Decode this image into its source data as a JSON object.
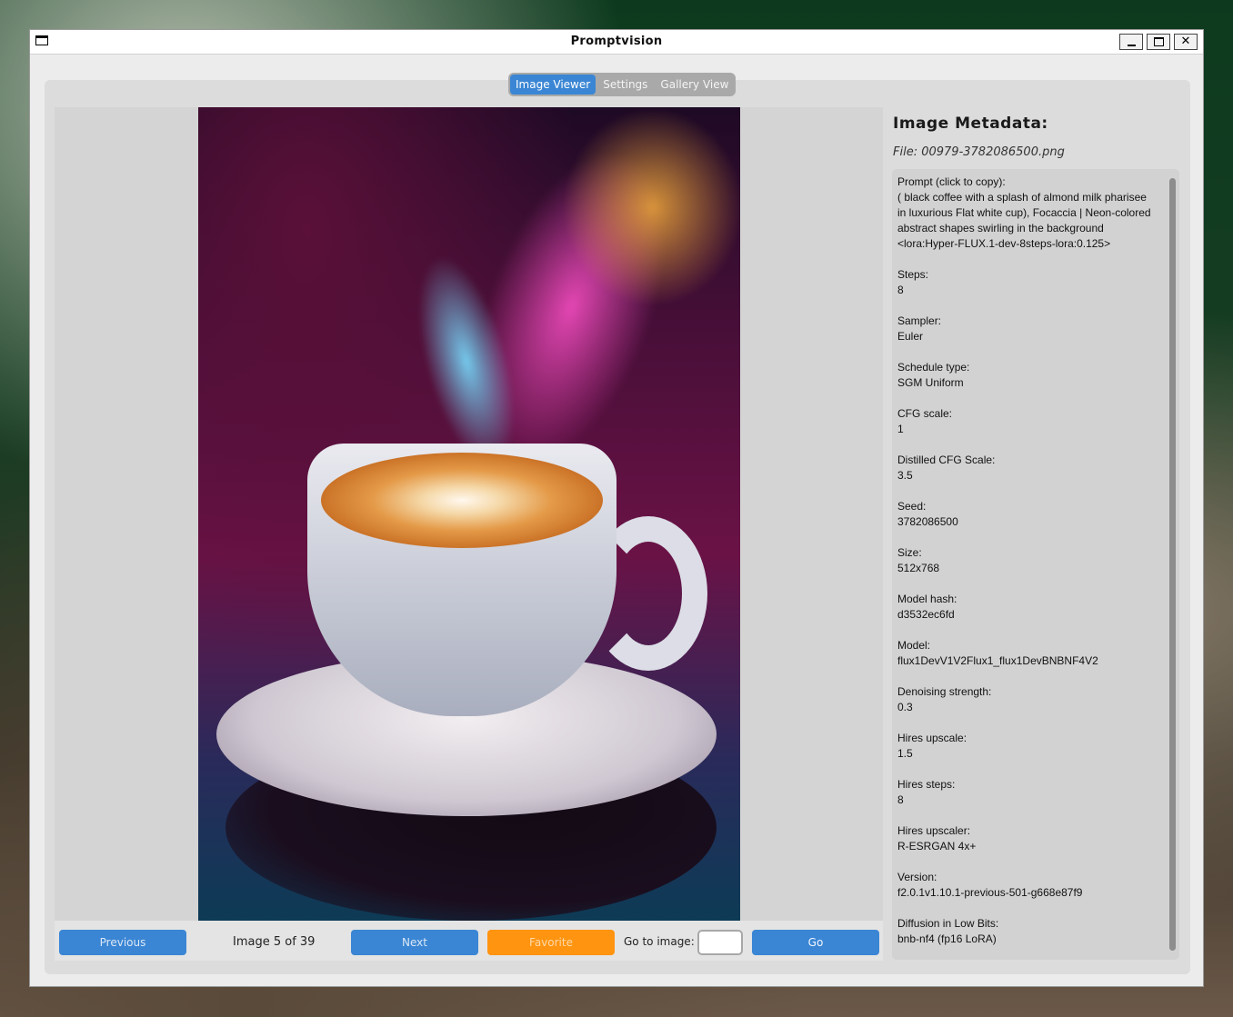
{
  "window": {
    "title": "Promptvision"
  },
  "tabs": [
    {
      "label": "Image Viewer",
      "active": true
    },
    {
      "label": "Settings",
      "active": false
    },
    {
      "label": "Gallery View",
      "active": false
    }
  ],
  "nav": {
    "previous_label": "Previous",
    "counter": "Image 5 of 39",
    "next_label": "Next",
    "favorite_label": "Favorite",
    "goto_label": "Go to image:",
    "goto_value": "",
    "go_label": "Go"
  },
  "metadata": {
    "title": "Image Metadata:",
    "file": "File: 00979-3782086500.png",
    "prompt_label": "Prompt (click to copy):",
    "prompt_value": "( black coffee with a splash of almond milk pharisee in luxurious Flat white cup), Focaccia | Neon-colored abstract shapes swirling in the background <lora:Hyper-FLUX.1-dev-8steps-lora:0.125>",
    "items": [
      {
        "key": "Steps:",
        "value": "8"
      },
      {
        "key": "Sampler:",
        "value": "Euler"
      },
      {
        "key": "Schedule type:",
        "value": "SGM Uniform"
      },
      {
        "key": "CFG scale:",
        "value": "1"
      },
      {
        "key": "Distilled CFG Scale:",
        "value": "3.5"
      },
      {
        "key": "Seed:",
        "value": "3782086500"
      },
      {
        "key": "Size:",
        "value": "512x768"
      },
      {
        "key": "Model hash:",
        "value": "d3532ec6fd"
      },
      {
        "key": "Model:",
        "value": "flux1DevV1V2Flux1_flux1DevBNBNF4V2"
      },
      {
        "key": "Denoising strength:",
        "value": "0.3"
      },
      {
        "key": "Hires upscale:",
        "value": "1.5"
      },
      {
        "key": "Hires steps:",
        "value": "8"
      },
      {
        "key": "Hires upscaler:",
        "value": "R-ESRGAN 4x+"
      },
      {
        "key": "Version:",
        "value": "f2.0.1v1.10.1-previous-501-g668e87f9"
      },
      {
        "key": "Diffusion in Low Bits:",
        "value": "bnb-nf4 (fp16 LoRA)"
      }
    ]
  },
  "colors": {
    "accent": "#3a86d4",
    "favorite": "#ff9410"
  }
}
